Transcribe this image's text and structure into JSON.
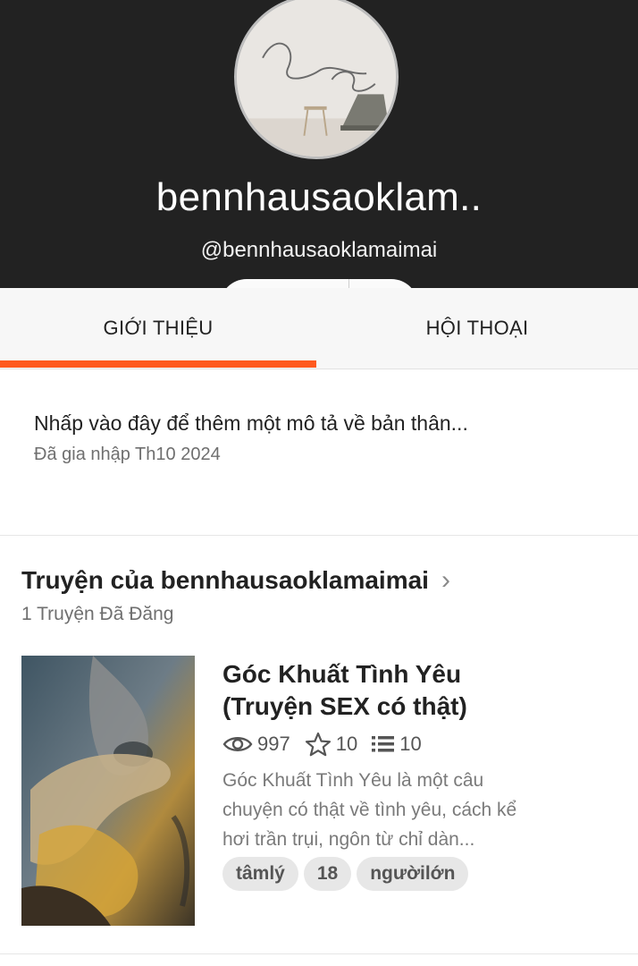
{
  "profile": {
    "display_name": "bennhausaoklam..",
    "handle": "@bennhausaoklamaimai"
  },
  "tabs": [
    {
      "label": "GIỚI THIỆU",
      "active": true
    },
    {
      "label": "HỘI THOẠI",
      "active": false
    }
  ],
  "about": {
    "prompt": "Nhấp vào đây để thêm một mô tả về bản thân...",
    "joined": "Đã gia nhập Th10 2024"
  },
  "stories": {
    "heading": "Truyện của bennhausaoklamaimai",
    "count": "1 Truyện Đã Đăng",
    "items": [
      {
        "title": "Góc Khuất Tình Yêu (Truyện SEX có thật)",
        "views": "997",
        "votes": "10",
        "parts": "10",
        "description": "Góc Khuất Tình Yêu là một câu chuyện có thật về tình yêu, cách kể hơi trần trụi, ngôn từ chỉ dàn...",
        "tags": [
          "tâmlý",
          "18",
          "ngườilớn"
        ]
      }
    ]
  },
  "colors": {
    "header_bg": "#222222",
    "accent": "#ff5a1f"
  }
}
